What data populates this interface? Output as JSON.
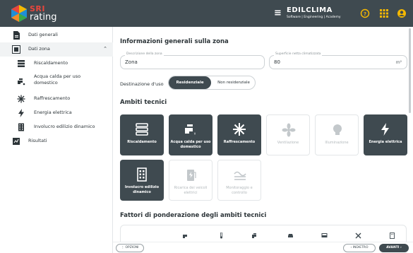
{
  "header": {
    "logo_sri": "SRI",
    "logo_rating": "rating",
    "brand_name": "EDILCLIMA",
    "brand_tagline": "Software | Engineering | Academy",
    "help_icon": "help-circle-icon",
    "apps_icon": "grid-icon",
    "user_icon": "user-icon",
    "accent_color": "#f5b800"
  },
  "sidebar": {
    "items": [
      {
        "label": "Dati generali",
        "icon": "document-icon"
      },
      {
        "label": "Dati zona",
        "icon": "zone-icon",
        "expanded": true
      },
      {
        "label": "Riscaldamento",
        "icon": "radiator-icon"
      },
      {
        "label": "Acqua calda per uso domestico",
        "icon": "faucet-icon"
      },
      {
        "label": "Raffrescamento",
        "icon": "snowflake-icon"
      },
      {
        "label": "Energia elettrica",
        "icon": "lightning-icon"
      },
      {
        "label": "Involucro edilizio dinamico",
        "icon": "building-icon"
      },
      {
        "label": "Risultati",
        "icon": "results-icon"
      }
    ]
  },
  "main": {
    "section_info": "Informazioni generali sulla zona",
    "field_descr": {
      "label": "Descrizione della zona",
      "value": "Zona"
    },
    "field_area": {
      "label": "Superficie netta climatizzata",
      "value": "80",
      "unit": "m²"
    },
    "destination_label": "Destinazione d'uso",
    "destination_options": [
      "Residenziale",
      "Non residenziale"
    ],
    "destination_selected": "Residenziale",
    "section_ambiti": "Ambiti tecnici",
    "tiles": [
      {
        "label": "Riscaldamento",
        "active": true,
        "icon": "radiator-icon"
      },
      {
        "label": "Acqua calda per uso domestico",
        "active": true,
        "icon": "faucet-icon"
      },
      {
        "label": "Raffrescamento",
        "active": true,
        "icon": "snowflake-icon"
      },
      {
        "label": "Ventilazione",
        "active": false,
        "icon": "fan-icon"
      },
      {
        "label": "Illuminazione",
        "active": false,
        "icon": "lightbulb-icon"
      },
      {
        "label": "Energia elettrica",
        "active": true,
        "icon": "lightning-icon"
      },
      {
        "label": "Involucro edilizio dinamico",
        "active": true,
        "icon": "building-icon"
      },
      {
        "label": "Ricarica dei veicoli elettrici",
        "active": false,
        "icon": "ev-charger-icon"
      },
      {
        "label": "Monitoraggio e controllo",
        "active": false,
        "icon": "monitoring-icon"
      }
    ],
    "section_weights": "Fattori di ponderazione degli ambiti tecnici",
    "active_color": "#3f4a50"
  },
  "footer": {
    "options_label": "OPZIONI",
    "back_label": "INDIETRO",
    "next_label": "AVANTI"
  }
}
